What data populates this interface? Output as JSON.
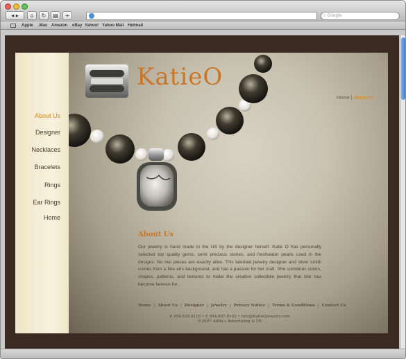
{
  "browser": {
    "search_placeholder": "Google",
    "bookmarks": [
      "Apple",
      ".Mac",
      "Amazon",
      "eBay",
      "Yahoo!",
      "Yahoo Mail",
      "Hotmail"
    ]
  },
  "site": {
    "logo_text": "KatieO",
    "nav": [
      {
        "label": "About Us",
        "active": true
      },
      {
        "label": "Designer",
        "active": false
      },
      {
        "label": "Necklaces",
        "active": false
      },
      {
        "label": "Bracelets",
        "active": false
      },
      {
        "label": "Rings",
        "active": false
      },
      {
        "label": "Ear Rings",
        "active": false
      },
      {
        "label": "Home",
        "active": false
      }
    ],
    "breadcrumb": {
      "home": "Home",
      "separator": "|",
      "current": "About Us"
    },
    "about_title": "About Us",
    "about_body": "Our jewelry is hand made in the US by the designer herself. Katie O has personally selected top quality gems, semi precious stones, and freshwater pearls used in the designs. No two pieces are exactly alike. This talented jewelry designer and silver smith comes from a fine arts background, and has a passion for her craft. She combines colors, shapes, patterns, and textures to make the creative collectible jewelry that she has become famous for.",
    "footer_links": [
      "Home",
      "About Us",
      "Designer",
      "Jewelry",
      "Privacy Notice",
      "Terms & Conditions",
      "Contact Us"
    ],
    "footer_contact": "P 954.638.9118 • F 954.697.8103 • info@KatieOJewelry.com",
    "footer_copyright": "©2007 AdBa's Advertising & PR"
  },
  "colors": {
    "accent": "#d9821d",
    "page_bg": "#3b2a22",
    "sidebar_bg": "#f5eed8"
  }
}
